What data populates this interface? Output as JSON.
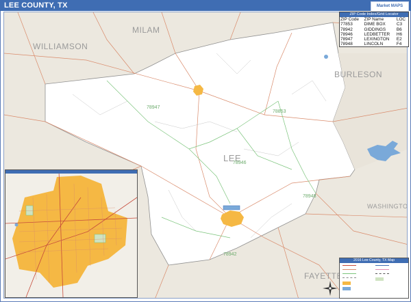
{
  "title": "LEE COUNTY, TX",
  "logo_text": "Market MAPS",
  "colors": {
    "title_bar": "#3f6db3",
    "county_fill": "#ffffff",
    "outside_fill": "#ece8df",
    "city_fill": "#f5b844",
    "roads": "#d98a6a",
    "zip_boundaries": "#7bc47b",
    "water": "#7aa9d9"
  },
  "county_labels": {
    "milam": "MILAM",
    "williamson": "WILLIAMSON",
    "burleson": "BURLESON",
    "lee": "LEE",
    "washington": "WASHINGTON",
    "fayette": "FAYETTE"
  },
  "zip_labels": {
    "z1": "78947",
    "z2": "78853",
    "z3": "78946",
    "z4": "78948",
    "z5": "78942"
  },
  "zip_table": {
    "title": "ZIP Code Index/Grid Locator",
    "headers": [
      "ZIP Code",
      "ZIP Name",
      "LOC"
    ],
    "rows": [
      [
        "77853",
        "DIME BOX",
        "C3"
      ],
      [
        "78942",
        "GIDDINGS",
        "B6"
      ],
      [
        "78946",
        "LEDBETTER",
        "H6"
      ],
      [
        "78947",
        "LEXINGTON",
        "E2"
      ],
      [
        "78948",
        "LINCOLN",
        "F4"
      ]
    ]
  },
  "legend": {
    "title": "2016 Lee County, TX Map"
  }
}
